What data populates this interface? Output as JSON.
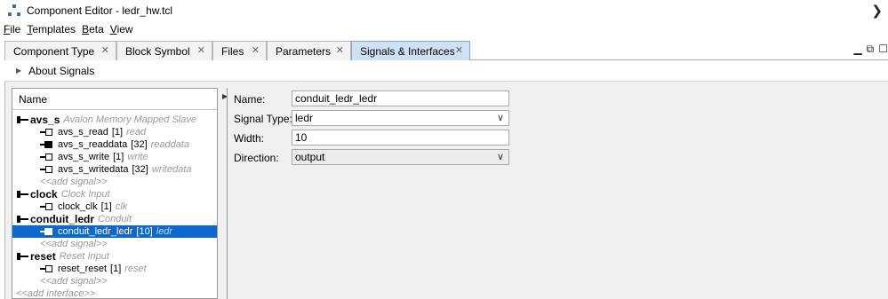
{
  "window": {
    "title": "Component Editor - ledr_hw.tcl"
  },
  "menu": [
    {
      "mnemonic": "F",
      "rest": "ile"
    },
    {
      "mnemonic": "T",
      "rest": "emplates"
    },
    {
      "mnemonic": "B",
      "rest": "eta"
    },
    {
      "mnemonic": "V",
      "rest": "iew"
    }
  ],
  "tabs": [
    {
      "label": "Component Type"
    },
    {
      "label": "Block Symbol"
    },
    {
      "label": "Files"
    },
    {
      "label": "Parameters"
    },
    {
      "label": "Signals & Interfaces"
    }
  ],
  "about": {
    "label": "About Signals"
  },
  "tree": {
    "header": "Name",
    "add_signal": "<<add signal>>",
    "add_interface": "<<add interface>>",
    "interfaces": [
      {
        "name": "avs_s",
        "desc": "Avalon Memory Mapped Slave",
        "signals": [
          {
            "name": "avs_s_read",
            "width": "[1]",
            "role": "read",
            "dir": "in"
          },
          {
            "name": "avs_s_readdata",
            "width": "[32]",
            "role": "readdata",
            "dir": "out"
          },
          {
            "name": "avs_s_write",
            "width": "[1]",
            "role": "write",
            "dir": "in"
          },
          {
            "name": "avs_s_writedata",
            "width": "[32]",
            "role": "writedata",
            "dir": "in"
          }
        ]
      },
      {
        "name": "clock",
        "desc": "Clock Input",
        "signals": [
          {
            "name": "clock_clk",
            "width": "[1]",
            "role": "clk",
            "dir": "in"
          }
        ]
      },
      {
        "name": "conduit_ledr",
        "desc": "Conduit",
        "signals": [
          {
            "name": "conduit_ledr_ledr",
            "width": "[10]",
            "role": "ledr",
            "dir": "out",
            "selected": true
          }
        ]
      },
      {
        "name": "reset",
        "desc": "Reset Input",
        "signals": [
          {
            "name": "reset_reset",
            "width": "[1]",
            "role": "reset",
            "dir": "in"
          }
        ]
      }
    ]
  },
  "details": {
    "name_label": "Name:",
    "name_value": "conduit_ledr_ledr",
    "type_label": "Signal Type:",
    "type_value": "ledr",
    "width_label": "Width:",
    "width_value": "10",
    "direction_label": "Direction:",
    "direction_value": "output"
  }
}
